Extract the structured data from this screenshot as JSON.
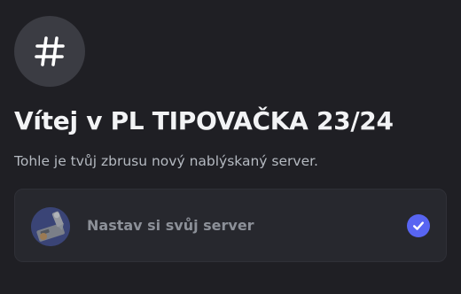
{
  "header": {
    "icon": "hashtag-icon",
    "title": "Vítej v PL TIPOVAČKA 23/24",
    "subtitle": "Tohle je tvůj zbrusu nový nablýskaný server."
  },
  "setup_card": {
    "icon": "server-setup-illustration-icon",
    "label": "Nastav si svůj server",
    "status_icon": "checkmark-circle-icon",
    "completed": true
  },
  "colors": {
    "background": "#1f1f24",
    "card": "#27282e",
    "accent": "#5865f2"
  }
}
